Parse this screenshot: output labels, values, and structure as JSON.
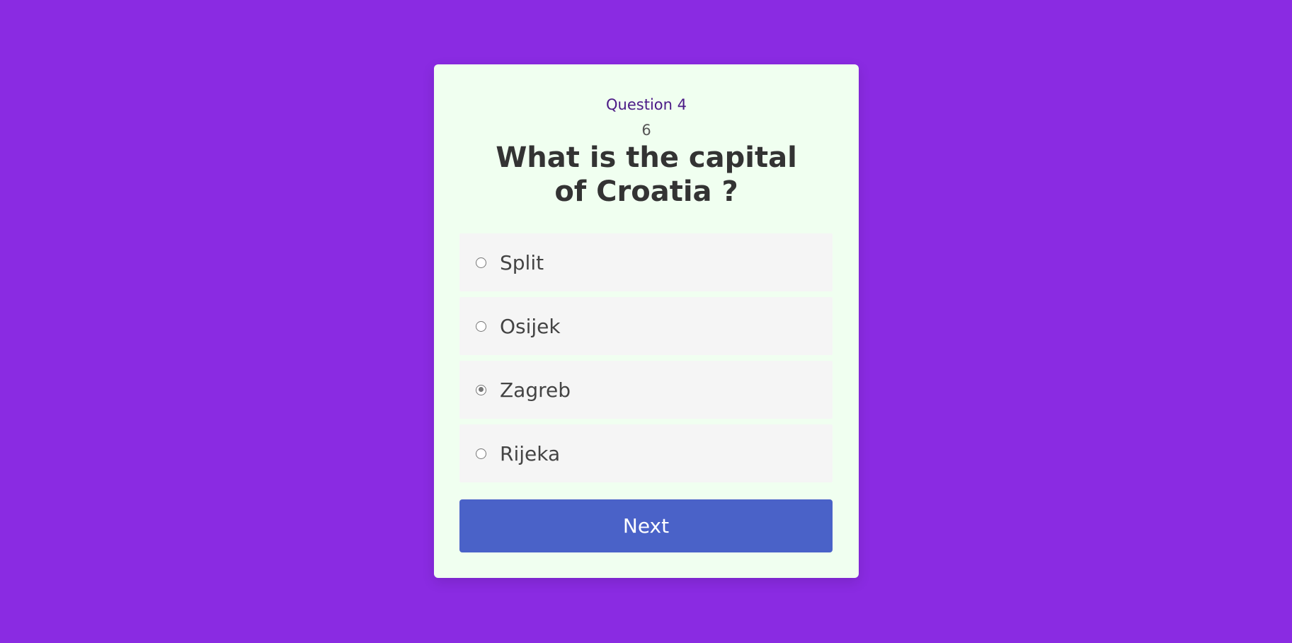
{
  "quiz": {
    "question_label": "Question 4",
    "score": "6",
    "question_text": "What is the capital of Croatia ?",
    "options": [
      {
        "label": "Split",
        "selected": false
      },
      {
        "label": "Osijek",
        "selected": false
      },
      {
        "label": "Zagreb",
        "selected": true
      },
      {
        "label": "Rijeka",
        "selected": false
      }
    ],
    "next_label": "Next"
  },
  "colors": {
    "background": "#8a2be2",
    "card": "#f0fff0",
    "option_bg": "#f5f5f5",
    "button": "#4a62c8",
    "question_label": "#4b1a86"
  }
}
